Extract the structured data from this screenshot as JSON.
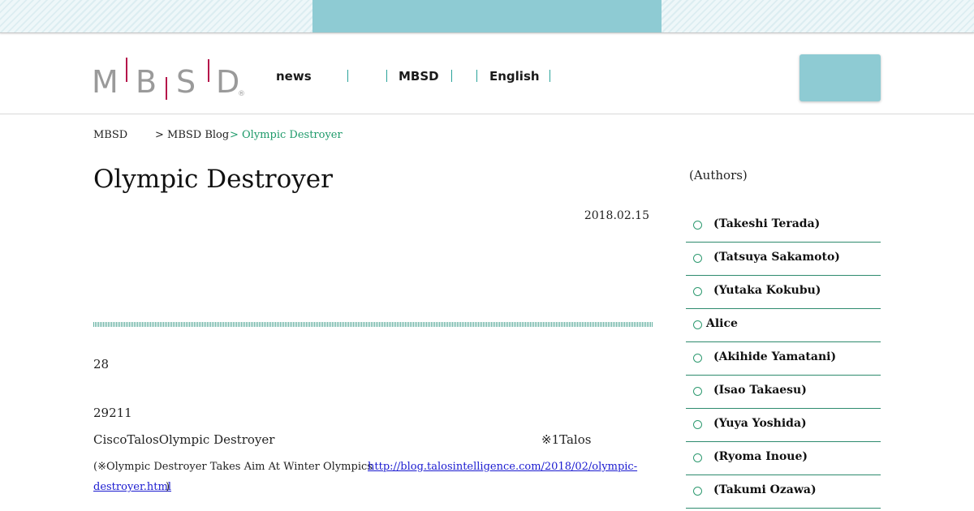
{
  "nav": {
    "items": [
      "news",
      "MBSD",
      "English"
    ]
  },
  "breadcrumb": {
    "home": "MBSD",
    "blog": "> MBSD Blog",
    "current": "> Olympic Destroyer"
  },
  "article": {
    "title": "Olympic Destroyer",
    "date": "2018.02.15",
    "p1": "28",
    "p2": "29211",
    "p3_left": "CiscoTalosOlympic Destroyer",
    "p3_right": "※1Talos",
    "note_text": "(※Olympic Destroyer Takes Aim At Winter Olympics",
    "note_link_1": "http://blog.talosintelligence.com/2018/02/olympic-",
    "note_link_2": "destroyer.html",
    "note_close": ")"
  },
  "sidebar": {
    "heading": "(Authors)",
    "authors": [
      "(Takeshi Terada)",
      "(Tatsuya Sakamoto)",
      "(Yutaka Kokubu)",
      "Alice",
      "(Akihide Yamatani)",
      "(Isao Takaesu)",
      "(Yuya Yoshida)",
      "(Ryoma Inoue)",
      "(Takumi Ozawa)"
    ]
  },
  "colors": {
    "accent_teal": "#8ecbd3",
    "logo_red": "#b5144a",
    "breadcrumb_green": "#1e9a6a",
    "divider_green": "#2e8b6e"
  }
}
